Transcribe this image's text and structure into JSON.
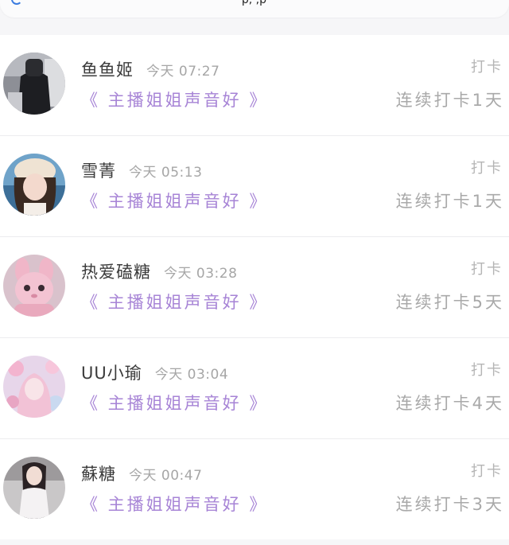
{
  "header": {
    "partial_text": "'p, ,p"
  },
  "entries": [
    {
      "name": "鱼鱼姬",
      "time": "今天 07:27",
      "song": "《 主播姐姐声音好 》",
      "action": "打卡",
      "streak": "连续打卡1天",
      "avatar_icon": "avatar-dark-outfit"
    },
    {
      "name": "雪菁",
      "time": "今天 05:13",
      "song": "《 主播姐姐声音好 》",
      "action": "打卡",
      "streak": "连续打卡1天",
      "avatar_icon": "avatar-girl-fur-hat"
    },
    {
      "name": "热爱磕糖",
      "time": "今天 03:28",
      "song": "《 主播姐姐声音好 》",
      "action": "打卡",
      "streak": "连续打卡5天",
      "avatar_icon": "avatar-pink-bunny"
    },
    {
      "name": "UU小瑜",
      "time": "今天 03:04",
      "song": "《 主播姐姐声音好 》",
      "action": "打卡",
      "streak": "连续打卡4天",
      "avatar_icon": "avatar-pink-fantasy"
    },
    {
      "name": "蘇糖",
      "time": "今天 00:47",
      "song": "《 主播姐姐声音好 》",
      "action": "打卡",
      "streak": "连续打卡3天",
      "avatar_icon": "avatar-white-dress"
    }
  ],
  "colors": {
    "song_link": "#a784d6",
    "muted_text": "#a9a9a9",
    "name_text": "#3b3b3b"
  }
}
